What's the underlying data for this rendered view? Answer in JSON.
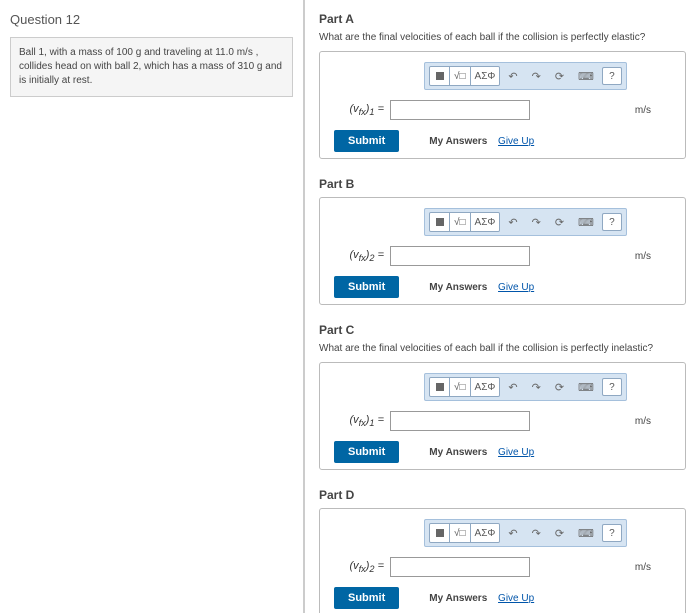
{
  "question": {
    "title": "Question 12",
    "text": "Ball 1, with a mass of 100 g and traveling at 11.0 m/s , collides head on with ball 2, which has a mass of 310 g and is initially at rest."
  },
  "toolbar": {
    "greek": "ΑΣΦ",
    "help": "?"
  },
  "actions": {
    "submit": "Submit",
    "my_answers": "My Answers",
    "give_up": "Give Up"
  },
  "parts": [
    {
      "id": "A",
      "title": "Part A",
      "prompt": "What are the final velocities of each ball if the collision is perfectly elastic?",
      "var": "(v_fx)_1 =",
      "unit": "m/s"
    },
    {
      "id": "B",
      "title": "Part B",
      "prompt": "",
      "var": "(v_fx)_2 =",
      "unit": "m/s"
    },
    {
      "id": "C",
      "title": "Part C",
      "prompt": "What are the final velocities of each ball if the collision is perfectly inelastic?",
      "var": "(v_fx)_1 =",
      "unit": "m/s"
    },
    {
      "id": "D",
      "title": "Part D",
      "prompt": "",
      "var": "(v_fx)_2 =",
      "unit": "m/s"
    }
  ]
}
